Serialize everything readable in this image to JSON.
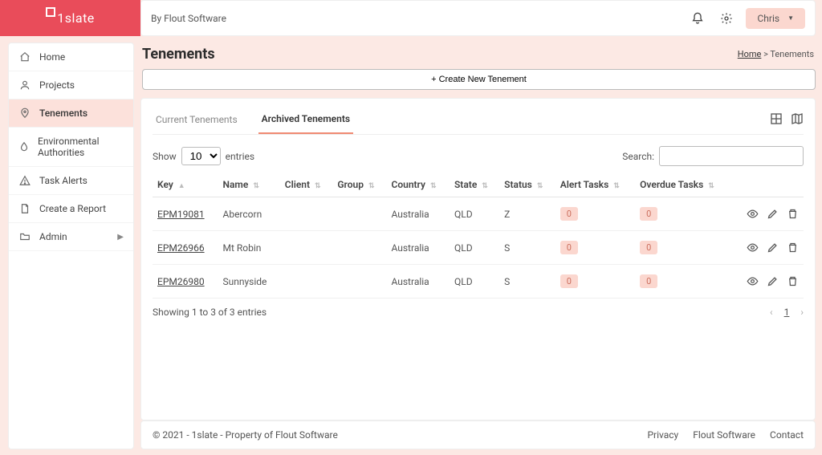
{
  "brand": {
    "name": "1slate"
  },
  "topbar": {
    "byline": "By Flout Software",
    "user": "Chris"
  },
  "sidebar": {
    "items": [
      {
        "label": "Home"
      },
      {
        "label": "Projects"
      },
      {
        "label": "Tenements"
      },
      {
        "label": "Environmental Authorities"
      },
      {
        "label": "Task Alerts"
      },
      {
        "label": "Create a Report"
      },
      {
        "label": "Admin"
      }
    ]
  },
  "page": {
    "title": "Tenements",
    "breadcrumb_home": "Home",
    "breadcrumb_sep": ">",
    "breadcrumb_current": "Tenements",
    "create_button": "+ Create New Tenement"
  },
  "tabs": {
    "current": "Current Tenements",
    "archived": "Archived Tenements"
  },
  "table_controls": {
    "show_prefix": "Show",
    "show_value": "10",
    "show_suffix": "entries",
    "search_label": "Search:"
  },
  "columns": {
    "key": "Key",
    "name": "Name",
    "client": "Client",
    "group": "Group",
    "country": "Country",
    "state": "State",
    "status": "Status",
    "alert": "Alert Tasks",
    "overdue": "Overdue Tasks"
  },
  "rows": [
    {
      "key": "EPM19081",
      "name": "Abercorn",
      "client": "",
      "group": "",
      "country": "Australia",
      "state": "QLD",
      "status": "Z",
      "alert": "0",
      "overdue": "0"
    },
    {
      "key": "EPM26966",
      "name": "Mt Robin",
      "client": "",
      "group": "",
      "country": "Australia",
      "state": "QLD",
      "status": "S",
      "alert": "0",
      "overdue": "0"
    },
    {
      "key": "EPM26980",
      "name": "Sunnyside",
      "client": "",
      "group": "",
      "country": "Australia",
      "state": "QLD",
      "status": "S",
      "alert": "0",
      "overdue": "0"
    }
  ],
  "table_footer": {
    "info": "Showing 1 to 3 of 3 entries",
    "prev": "‹",
    "page": "1",
    "next": "›"
  },
  "footer": {
    "copyright": "© 2021 - 1slate - Property of Flout Software",
    "links": {
      "privacy": "Privacy",
      "flout": "Flout Software",
      "contact": "Contact"
    }
  }
}
